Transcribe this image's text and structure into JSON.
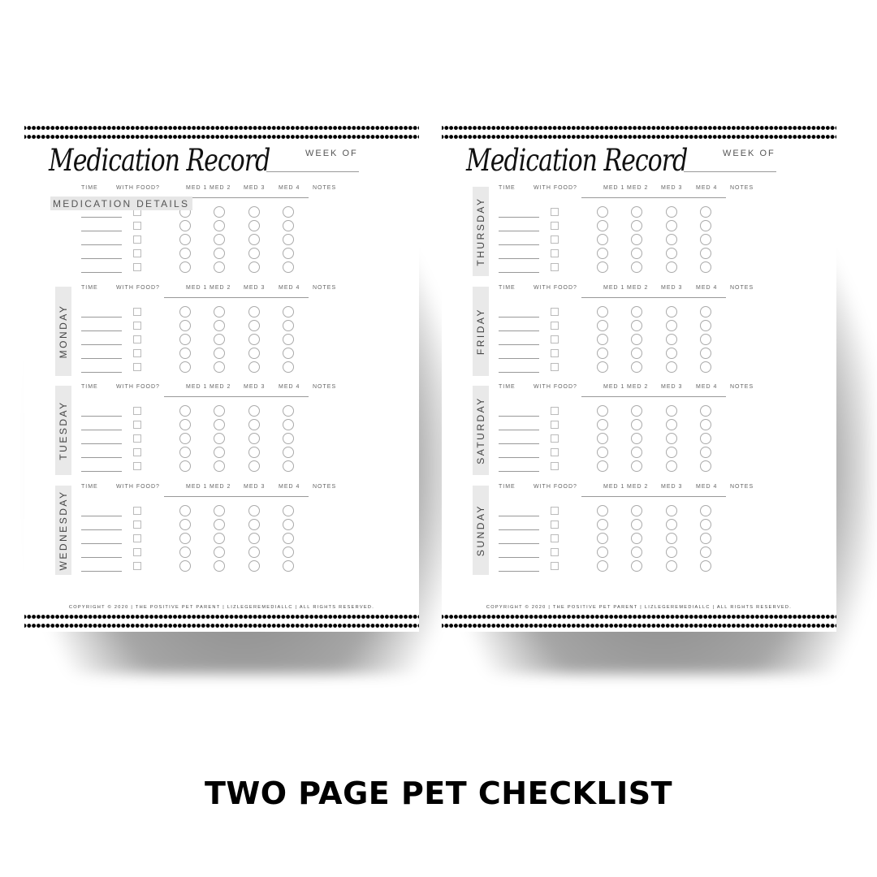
{
  "product_title": "TWO PAGE PET CHECKLIST",
  "pages": [
    {
      "title": "Medication Record",
      "week_of_label": "WEEK OF",
      "overlay_label": "MEDICATION DETAILS",
      "sections": [
        {
          "day": ""
        },
        {
          "day": "MONDAY"
        },
        {
          "day": "TUESDAY"
        },
        {
          "day": "WEDNESDAY"
        }
      ],
      "copyright": "COPYRIGHT © 2020 | THE POSITIVE PET PARENT | LIZLEGEREMEDIALLC | ALL RIGHTS RESERVED."
    },
    {
      "title": "Medication Record",
      "week_of_label": "WEEK OF",
      "sections": [
        {
          "day": "THURSDAY"
        },
        {
          "day": "FRIDAY"
        },
        {
          "day": "SATURDAY"
        },
        {
          "day": "SUNDAY"
        }
      ],
      "copyright": "COPYRIGHT © 2020 | THE POSITIVE PET PARENT | LIZLEGEREMEDIALLC | ALL RIGHTS RESERVED."
    }
  ],
  "columns": [
    "TIME",
    "WITH FOOD?",
    "MED 1",
    "MED 2",
    "MED 3",
    "MED 4",
    "NOTES"
  ],
  "rows_per_day": 5
}
